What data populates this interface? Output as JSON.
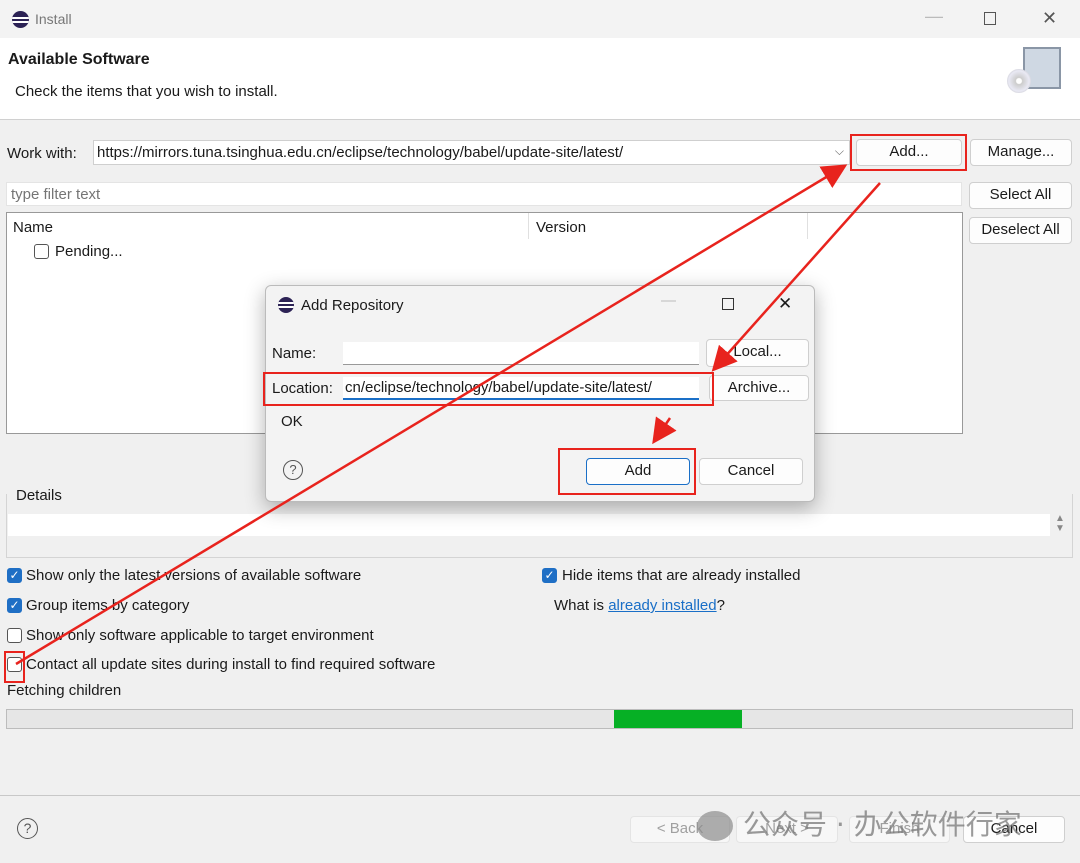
{
  "window": {
    "title": "Install",
    "controls": [
      "minimize",
      "maximize",
      "close"
    ]
  },
  "header": {
    "title": "Available Software",
    "subtitle": "Check the items that you wish to install."
  },
  "work_with": {
    "label": "Work with:",
    "value": "https://mirrors.tuna.tsinghua.edu.cn/eclipse/technology/babel/update-site/latest/",
    "add": "Add...",
    "manage": "Manage..."
  },
  "filter": {
    "placeholder": "type filter text"
  },
  "buttons": {
    "select_all": "Select All",
    "deselect_all": "Deselect All"
  },
  "tree": {
    "columns": [
      "Name",
      "Version"
    ],
    "rows": [
      {
        "name": "Pending...",
        "checked": false
      }
    ]
  },
  "details": {
    "label": "Details"
  },
  "options": {
    "latest": {
      "label": "Show only the latest versions of available software",
      "checked": true
    },
    "group": {
      "label": "Group items by category",
      "checked": true
    },
    "applicable": {
      "label": "Show only software applicable to target environment",
      "checked": false
    },
    "contact": {
      "label": "Contact all update sites during install to find required software",
      "checked": false
    },
    "hide": {
      "label": "Hide items that are already installed",
      "checked": true
    },
    "what_is": "What is ",
    "already_installed": "already installed",
    "qmark": "?"
  },
  "status": {
    "text": "Fetching children",
    "progress_fraction": 0.12,
    "progress_color": "#06b025"
  },
  "footer": {
    "back": "< Back",
    "next": "Next >",
    "finish": "Finish",
    "cancel": "Cancel"
  },
  "dialog": {
    "title": "Add Repository",
    "name_label": "Name:",
    "name_value": "",
    "local": "Local...",
    "location_label": "Location:",
    "location_value": "cn/eclipse/technology/babel/update-site/latest/",
    "archive": "Archive...",
    "message": "OK",
    "add": "Add",
    "cancel": "Cancel"
  },
  "watermark": "公众号 · 办公软件行家",
  "annotation_color": "#e8231d"
}
